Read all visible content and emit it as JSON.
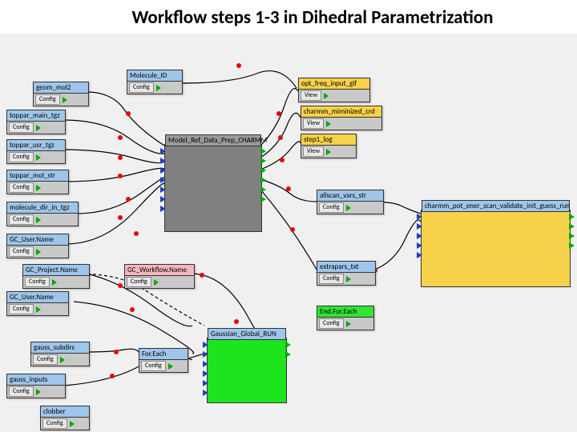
{
  "title": "Workflow steps 1-3 in Dihedral Parametrization",
  "btn": {
    "config": "Config",
    "view": "View"
  },
  "nodes": {
    "molecule_id": "Molecule_ID",
    "geom_mol2": "geom_mol2",
    "toppar_main_tgz": "toppar_main_tgz",
    "toppar_usr_tgz": "toppar_usr_tgz",
    "toppar_mol_str": "toppar_mol_str",
    "molecule_dir_in_tgz": "molecule_dir_in_tgz",
    "gc_username": "GC_User.Name",
    "gc_projectname": "GC_Project.Name",
    "gc_workflowname": "GC_Workflow.Name",
    "gauss_subdirs": "gauss_subdirs",
    "gauss_inputs": "gauss_inputs",
    "clobber": "clobber",
    "foreach": "For.Each",
    "end_foreach": "End.For.Each",
    "opt_freq_input_gif": "opt_freq_input_gif",
    "charmm_minimized_crd": "charmm_miminized_crd",
    "step1_log": "step1_log",
    "allscan_vars_str": "allscan_vars_str",
    "extrapars_txt": "extrapars_txt",
    "model_ref": "Model_Ref_Data_Prep_CHARMM",
    "gaussian_run": "Gaussian_Global_RUN",
    "charmm_scan": "charmm_pot_ener_scan_validate_init_guess_run"
  }
}
